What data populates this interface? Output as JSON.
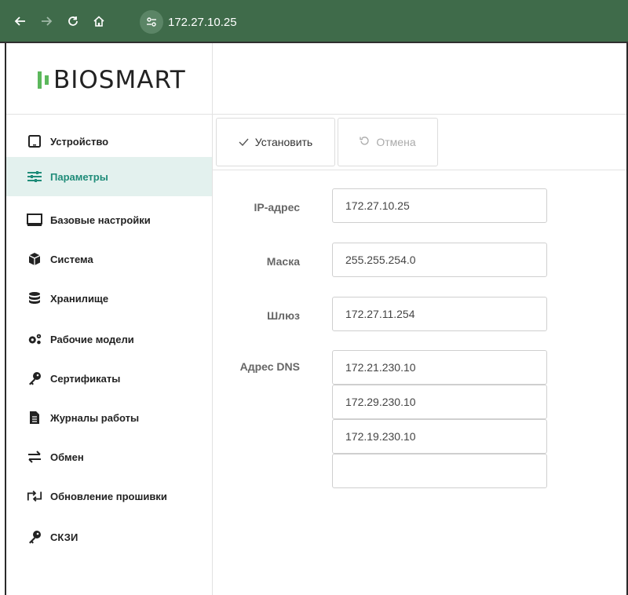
{
  "browser": {
    "url": "172.27.10.25",
    "icons": [
      "back-icon",
      "forward-icon",
      "reload-icon",
      "home-icon",
      "site-settings-icon"
    ]
  },
  "app": {
    "logo_text": "BIOSMART",
    "accent_color": "#1f8c79",
    "brand_color": "#5cb85c"
  },
  "sidebar": {
    "items": [
      {
        "label": "Устройство",
        "icon": "tablet-icon"
      },
      {
        "label": "Параметры",
        "icon": "sliders-icon",
        "active": true
      },
      {
        "label": "Базовые настройки",
        "icon": "monitor-icon"
      },
      {
        "label": "Система",
        "icon": "cube-icon"
      },
      {
        "label": "Хранилище",
        "icon": "database-icon"
      },
      {
        "label": "Рабочие модели",
        "icon": "gears-icon"
      },
      {
        "label": "Сертификаты",
        "icon": "key-icon"
      },
      {
        "label": "Журналы работы",
        "icon": "file-icon"
      },
      {
        "label": "Обмен",
        "icon": "exchange-icon"
      },
      {
        "label": "Обновление прошивки",
        "icon": "update-icon"
      },
      {
        "label": "СКЗИ",
        "icon": "key-icon"
      }
    ]
  },
  "toolbar": {
    "apply_label": "Установить",
    "cancel_label": "Отмена"
  },
  "form": {
    "ip_label": "IP-адрес",
    "ip_value": "172.27.10.25",
    "mask_label": "Маска",
    "mask_value": "255.255.254.0",
    "gateway_label": "Шлюз",
    "gateway_value": "172.27.11.254",
    "dns_label": "Адрес DNS",
    "dns_values": [
      "172.21.230.10",
      "172.29.230.10",
      "172.19.230.10",
      ""
    ]
  }
}
